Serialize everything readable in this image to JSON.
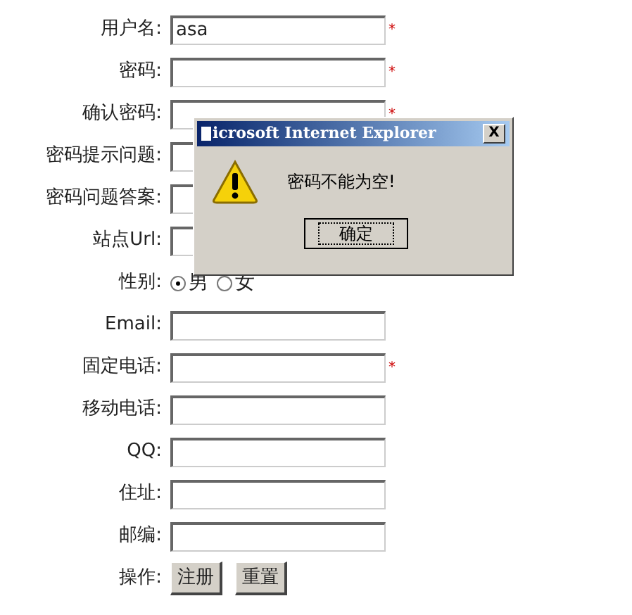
{
  "form": {
    "rows": [
      {
        "kind": "text",
        "label": "用户名:",
        "value": "asa",
        "note": "*"
      },
      {
        "kind": "text",
        "label": "密码:",
        "note": "*"
      },
      {
        "kind": "text",
        "label": "确认密码:",
        "note": "*"
      },
      {
        "kind": "text",
        "label": "密码提示问题:"
      },
      {
        "kind": "text",
        "label": "密码问题答案:"
      },
      {
        "kind": "text",
        "label": "站点Url:"
      },
      {
        "kind": "radio",
        "label": "性别:",
        "options": [
          {
            "label": "男",
            "selected": true
          },
          {
            "label": "女",
            "selected": false
          }
        ]
      },
      {
        "kind": "text",
        "label": "Email:"
      },
      {
        "kind": "text",
        "label": "固定电话:",
        "note": "*"
      },
      {
        "kind": "text",
        "label": "移动电话:"
      },
      {
        "kind": "text",
        "label": "QQ:"
      },
      {
        "kind": "text",
        "label": "住址:"
      },
      {
        "kind": "text",
        "label": "邮编:"
      },
      {
        "kind": "buttons",
        "label": "操作:",
        "buttons": [
          "注册",
          "重置"
        ]
      }
    ]
  },
  "dialog": {
    "title": "icrosoft Internet Explorer",
    "close": "X",
    "message": "密码不能为空!",
    "button": "确定"
  }
}
